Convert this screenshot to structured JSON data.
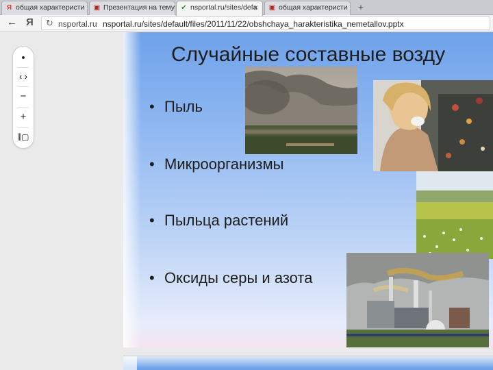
{
  "browser": {
    "tabs": [
      {
        "title": "общая характеристи",
        "favicon": "Я",
        "active": false
      },
      {
        "title": "Презентация на тему",
        "favicon": "▣",
        "active": false
      },
      {
        "title": "nsportal.ru/sites/defa",
        "favicon": "✔",
        "active": true
      },
      {
        "title": "общая характеристи",
        "favicon": "▣",
        "active": false
      }
    ],
    "close_glyph": "×",
    "new_tab_glyph": "+",
    "back_glyph": "←",
    "yandex_logo": "Я",
    "reload_glyph": "↻",
    "url_domain": "nsportal.ru",
    "url_full": "nsportal.ru/sites/default/files/2011/11/22/obshchaya_harakteristika_nemetallov.pptx"
  },
  "viewer_toolbar": {
    "dot_glyph": "•",
    "nav_glyph": "‹ ›",
    "zoom_out_glyph": "−",
    "zoom_in_glyph": "+",
    "fit_glyph": "⫼▢"
  },
  "slide": {
    "title": "Случайные составные возду",
    "bullet_glyph": "•",
    "bullets": [
      "Пыль",
      "Микроорганизмы",
      "Пыльца растений",
      "Оксиды серы и азота"
    ]
  },
  "icons": {
    "back": "arrow-left-icon",
    "reload": "reload-icon",
    "close": "close-icon",
    "add": "plus-icon",
    "minus": "minus-icon",
    "fit": "fit-page-icon"
  }
}
